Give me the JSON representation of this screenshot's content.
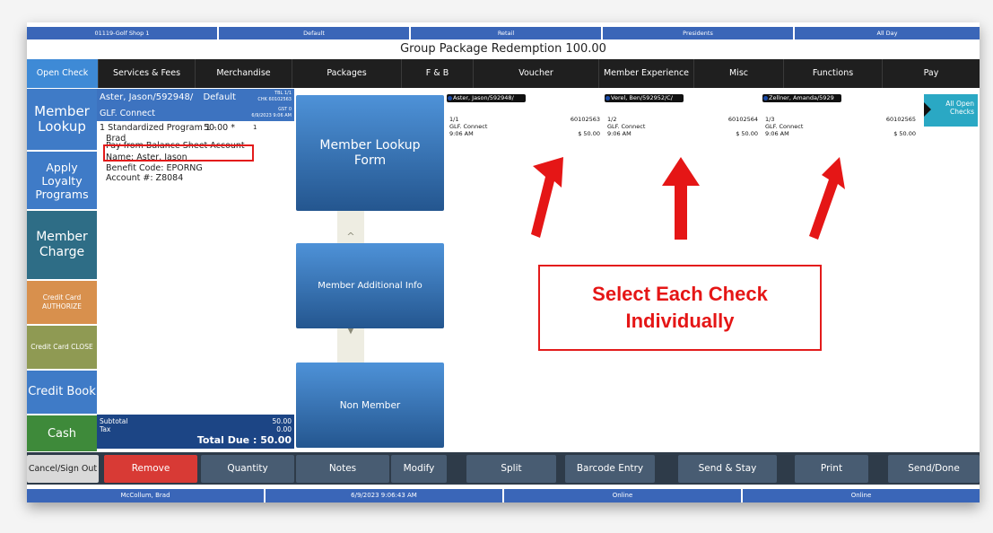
{
  "infobar": [
    "01119-Golf Shop 1",
    "Default",
    "Retail",
    "Presidents",
    "All Day"
  ],
  "title": "Group Package Redemption 100.00",
  "tabs": [
    "Open Check",
    "Services & Fees",
    "Merchandise",
    "Packages",
    "F & B",
    "Voucher",
    "Member Experience",
    "Misc",
    "Functions",
    "Pay"
  ],
  "left_buttons": [
    {
      "label": "Member Lookup",
      "color": "#3f7bc7"
    },
    {
      "label": "Apply Loyalty Programs",
      "color": "#3f7bc7"
    },
    {
      "label": "Member Charge",
      "color": "#2e6d86"
    },
    {
      "label": "Credit Card AUTHORIZE",
      "color": "#d8904d"
    },
    {
      "label": "Credit Card CLOSE",
      "color": "#8f9a53"
    },
    {
      "label": "Credit Book",
      "color": "#3f7bc7"
    },
    {
      "label": "Cash",
      "color": "#3e8a3a"
    }
  ],
  "receipt": {
    "header_name": "Aster, Jason/592948/",
    "header_default": "Default",
    "tbl": "TBL 1/1",
    "chk": "CHK 60102563",
    "gst": "GST 0",
    "datetime": "6/9/2023 9:06 AM",
    "subheader": "GLF. Connect",
    "line1_item": "1  Standardized Program 1 -",
    "line1_price": "50.00 *",
    "line1_mark": "1",
    "line1_cont": "Brad",
    "pay_line": "Pay from Balance Sheet Account",
    "name_line": "Name: Aster, Jason",
    "benefit": "Benefit Code: EPORNG",
    "account": "Account #: Z8084",
    "subtotal_label": "Subtotal",
    "subtotal_value": "50.00",
    "tax_label": "Tax",
    "tax_value": "0.00",
    "total_due": "Total Due :  50.00"
  },
  "middle_buttons": [
    "Member Lookup Form",
    "Member Additional Info",
    "Non Member"
  ],
  "checks": [
    {
      "name": "Aster, Jason/592948/",
      "seq": "1/1",
      "num": "60102563",
      "type": "GLF. Connect",
      "time": "9:06 AM",
      "amount": "$ 50.00"
    },
    {
      "name": "Verel, Ben/592952/C/",
      "seq": "1/2",
      "num": "60102564",
      "type": "GLF. Connect",
      "time": "9:06 AM",
      "amount": "$ 50.00"
    },
    {
      "name": "Zellner, Amanda/5929",
      "seq": "1/3",
      "num": "60102565",
      "type": "GLF. Connect",
      "time": "9:06 AM",
      "amount": "$ 50.00"
    }
  ],
  "all_open_checks": "All Open Checks",
  "annotation_text": "Select Each Check Individually",
  "bottom_buttons": [
    "Cancel/Sign Out",
    "Remove",
    "Quantity",
    "Notes",
    "Modify",
    "Split",
    "Barcode Entry",
    "Send & Stay",
    "Print",
    "Send/Done"
  ],
  "statusbar": [
    "McCollum, Brad",
    "6/9/2023 9:06:43 AM",
    "Online",
    "Online"
  ]
}
